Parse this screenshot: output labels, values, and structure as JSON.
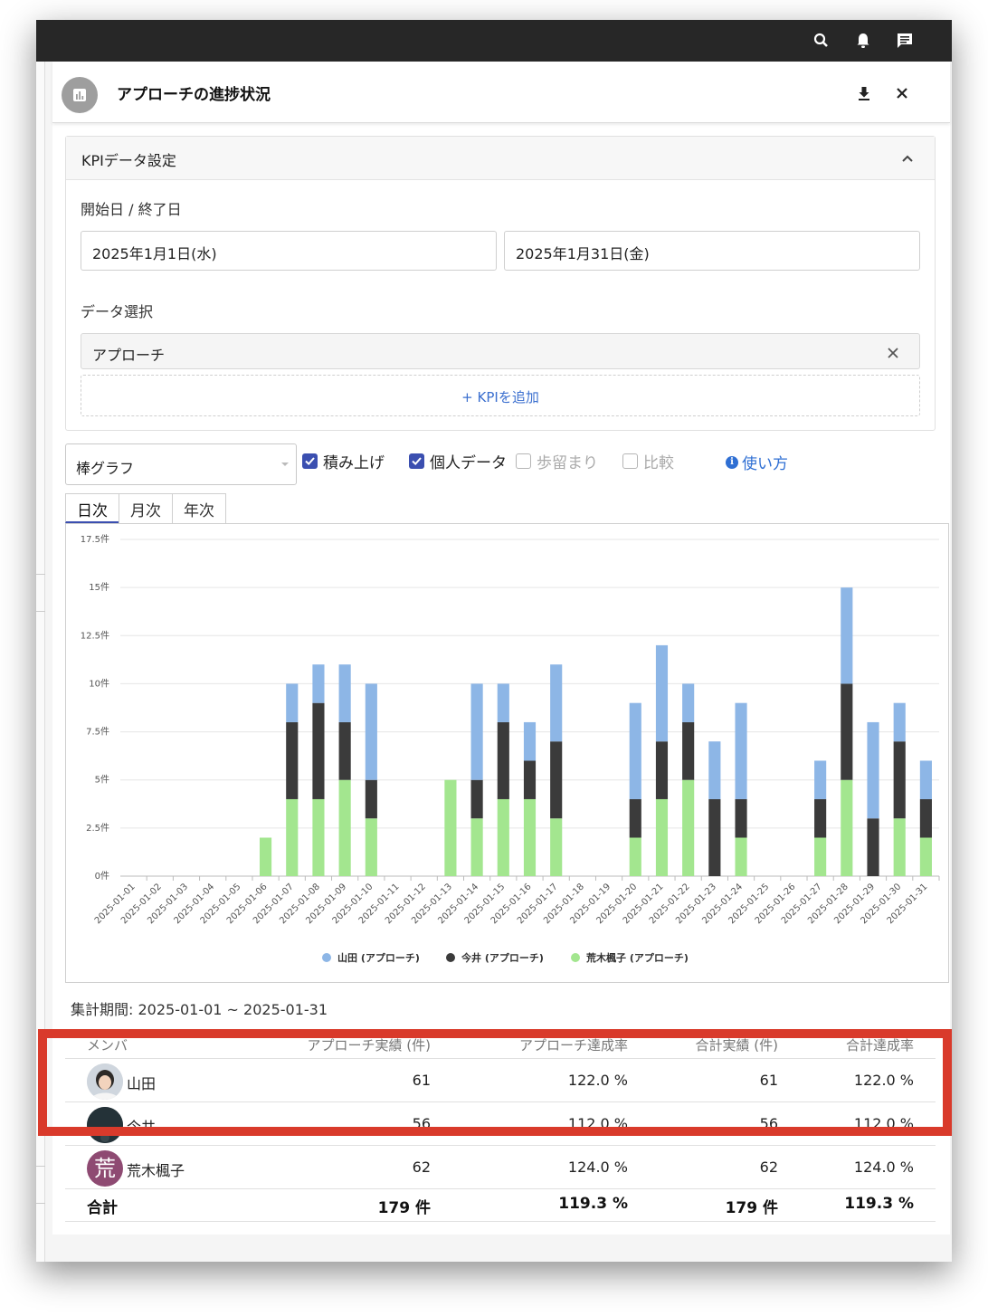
{
  "topbar": {
    "icons": [
      "search-icon",
      "bell-icon",
      "chat-icon"
    ]
  },
  "header": {
    "title": "アプローチの進捗状況",
    "icons": [
      "chart-icon",
      "download-icon",
      "close-icon"
    ]
  },
  "kpi_settings": {
    "title": "KPIデータ設定",
    "date_label": "開始日 / 終了日",
    "start_date": "2025年1月1日(水)",
    "end_date": "2025年1月31日(金)",
    "data_label": "データ選択",
    "selected_data": "アプローチ",
    "add_kpi": "+ KPIを追加"
  },
  "controls": {
    "chart_type": "棒グラフ",
    "stacked": {
      "label": "積み上げ",
      "checked": true
    },
    "individual": {
      "label": "個人データ",
      "checked": true
    },
    "yield": {
      "label": "歩留まり",
      "checked": false
    },
    "compare": {
      "label": "比較",
      "checked": false
    },
    "help": "使い方"
  },
  "tabs": [
    "日次",
    "月次",
    "年次"
  ],
  "active_tab": "日次",
  "chart_data": {
    "type": "bar",
    "stacked": true,
    "categories": [
      "2025-01-01",
      "2025-01-02",
      "2025-01-03",
      "2025-01-04",
      "2025-01-05",
      "2025-01-06",
      "2025-01-07",
      "2025-01-08",
      "2025-01-09",
      "2025-01-10",
      "2025-01-11",
      "2025-01-12",
      "2025-01-13",
      "2025-01-14",
      "2025-01-15",
      "2025-01-16",
      "2025-01-17",
      "2025-01-18",
      "2025-01-19",
      "2025-01-20",
      "2025-01-21",
      "2025-01-22",
      "2025-01-23",
      "2025-01-24",
      "2025-01-25",
      "2025-01-26",
      "2025-01-27",
      "2025-01-28",
      "2025-01-29",
      "2025-01-30",
      "2025-01-31"
    ],
    "series": [
      {
        "name": "荒木楓子 (アプローチ)",
        "color": "#a3e68f",
        "values": [
          0,
          0,
          0,
          0,
          0,
          2,
          4,
          4,
          5,
          3,
          0,
          0,
          5,
          3,
          4,
          4,
          3,
          0,
          0,
          2,
          4,
          5,
          0,
          2,
          0,
          0,
          2,
          5,
          0,
          3,
          2
        ]
      },
      {
        "name": "今井 (アプローチ)",
        "color": "#3b3b3b",
        "values": [
          0,
          0,
          0,
          0,
          0,
          0,
          4,
          5,
          3,
          2,
          0,
          0,
          0,
          2,
          4,
          2,
          4,
          0,
          0,
          2,
          3,
          3,
          4,
          2,
          0,
          0,
          2,
          5,
          3,
          4,
          2
        ]
      },
      {
        "name": "山田 (アプローチ)",
        "color": "#8db6e6",
        "values": [
          0,
          0,
          0,
          0,
          0,
          0,
          2,
          2,
          3,
          5,
          0,
          0,
          0,
          5,
          2,
          2,
          4,
          0,
          0,
          5,
          5,
          2,
          3,
          5,
          0,
          0,
          2,
          5,
          5,
          2,
          2
        ]
      }
    ],
    "legend_order": [
      "山田 (アプローチ)",
      "今井 (アプローチ)",
      "荒木楓子 (アプローチ)"
    ],
    "yticks": [
      "0件",
      "2.5件",
      "5件",
      "7.5件",
      "10件",
      "12.5件",
      "15件",
      "17.5件"
    ],
    "ylim": [
      0,
      17.5
    ],
    "grid": true,
    "legend_position": "bottom"
  },
  "summary": {
    "period": "集計期間: 2025-01-01 ~ 2025-01-31",
    "headers": [
      "メンバ",
      "アプローチ実績 (件)",
      "アプローチ達成率",
      "合計実績 (件)",
      "合計達成率"
    ],
    "rows": [
      {
        "name": "山田",
        "approach": "61",
        "rate": "122.0 %",
        "total": "61",
        "total_rate": "122.0 %"
      },
      {
        "name": "今井",
        "approach": "56",
        "rate": "112.0 %",
        "total": "56",
        "total_rate": "112.0 %"
      },
      {
        "name": "荒木楓子",
        "avatar_char": "荒",
        "approach": "62",
        "rate": "124.0 %",
        "total": "62",
        "total_rate": "124.0 %"
      }
    ],
    "total": {
      "label": "合計",
      "approach": "179 件",
      "rate": "119.3 %",
      "total": "179 件",
      "total_rate": "119.3 %"
    }
  },
  "colors": {
    "accent": "#3b4fb0",
    "link": "#2f6fd3",
    "highlight": "#d93a2b"
  }
}
